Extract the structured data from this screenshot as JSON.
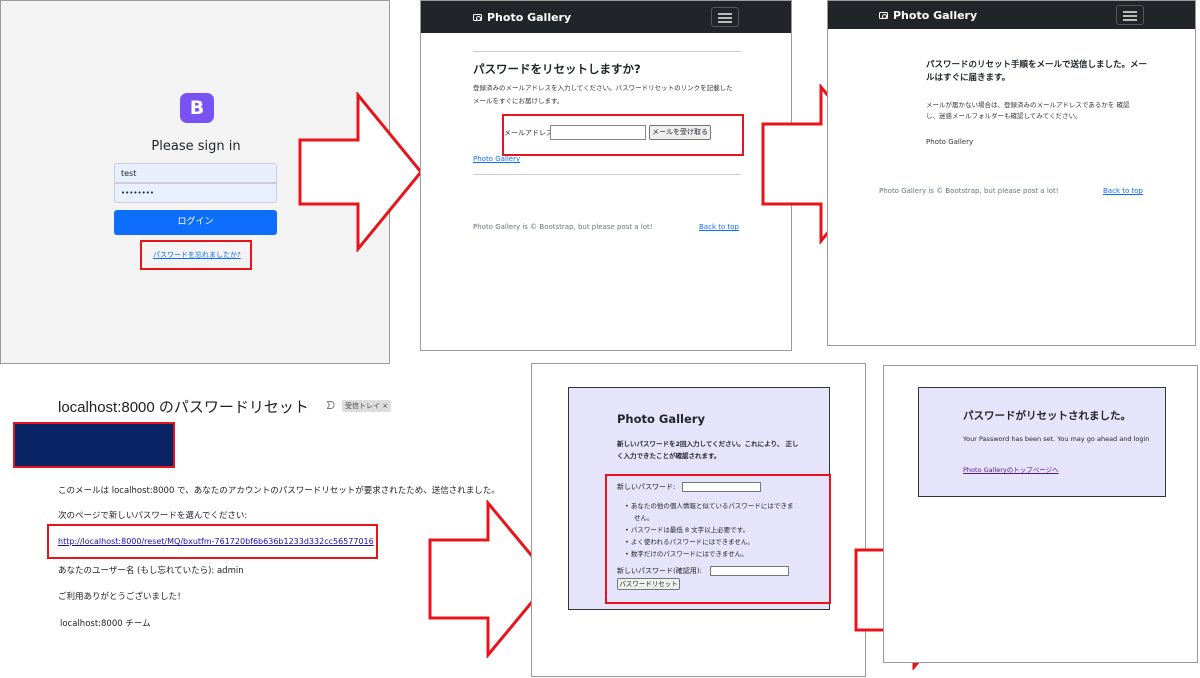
{
  "panel1": {
    "logo_letter": "B",
    "heading": "Please sign in",
    "username_value": "test",
    "password_value": "••••••••",
    "login_button": "ログイン",
    "forgot_link": "パスワードを忘れましたか?"
  },
  "panel2": {
    "brand": "Photo Gallery",
    "title": "パスワードをリセットしますか?",
    "desc_line1": "登録済みのメールアドレスを入力してください。パスワードリセットのリンクを記載した",
    "desc_line2": "メールをすぐにお届けします。",
    "email_label": "メールアドレス:",
    "email_value": "",
    "submit_button": "メールを受け取る",
    "home_link": "Photo Gallery",
    "footer_text": "Photo Gallery is © Bootstrap, but please post a lot!",
    "back_to_top": "Back to top"
  },
  "panel3": {
    "brand": "Photo Gallery",
    "msg_line1": "パスワードのリセット手順をメールで送信しました。メー",
    "msg_line2": "ルはすぐに届きます。",
    "note_line1": "メールが届かない場合は、登録済みのメールアドレスであるかを 確認",
    "note_line2": "し、迷惑メールフォルダーも確認してみてください。",
    "signature": "Photo Gallery",
    "footer_text": "Photo Gallery is © Bootstrap, but please post a lot!",
    "back_to_top": "Back to top"
  },
  "email": {
    "subject": "localhost:8000 のパスワードリセット",
    "label_badge": "受信トレイ ×",
    "body_line1": "このメールは localhost:8000 で、あなたのアカウントのパスワードリセットが要求されたため、送信されました。",
    "body_line2": "次のページで新しいパスワードを選んでください:",
    "reset_link": "http://localhost:8000/reset/MQ/bxutfm-761720bf6b636b1233d332cc56577016",
    "username_line": "あなたのユーザー名 (もし忘れていたら): admin",
    "thanks": "ご利用ありがとうございました！",
    "team": "localhost:8000 チーム",
    "redacted_color": "#0b2466"
  },
  "panel5": {
    "title": "Photo Gallery",
    "intro_line1": "新しいパスワードを2回入力してください。これにより、 正し",
    "intro_line2": "く入力できたことが確認されます。",
    "new_password_label": "新しいパスワード:",
    "rules": [
      "あなたの他の個人情報と似ているパスワードにはできま",
      "せん。",
      "パスワードは最低 8 文字以上必要です。",
      "よく使われるパスワードにはできません。",
      "数字だけのパスワードにはできません。"
    ],
    "confirm_label": "新しいパスワード(確認用):",
    "reset_button": "パスワードリセット"
  },
  "panel6": {
    "title": "パスワードがリセットされました。",
    "body": "Your Password has been set. You may go ahead and login",
    "link": "Photo Galleryのトップページへ"
  },
  "colors": {
    "accent_red": "#e8141c",
    "bootstrap_blue": "#0d6efd",
    "bootstrap_purple": "#7952f3",
    "navbar_dark": "#212529",
    "lavender_bg": "#e6e4fb"
  }
}
